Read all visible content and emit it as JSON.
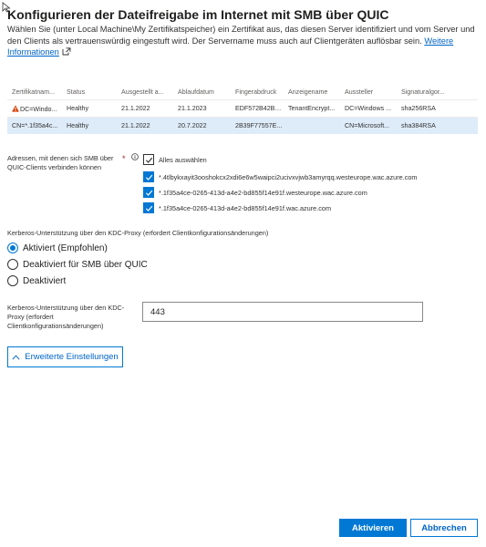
{
  "dialog": {
    "title": "Konfigurieren der Dateifreigabe im Internet mit SMB über QUIC",
    "description": "Wählen Sie (unter Local Machine\\My Zertifikatspeicher) ein Zertifikat aus, das diesen Server identifiziert und vom Server und den Clients als vertrauenswürdig eingestuft wird. Der Servername muss auch auf Clientgeräten auflösbar sein.",
    "link_label": "Weitere Informationen"
  },
  "certificates": {
    "columns": [
      "Zertifikatnam...",
      "Status",
      "Ausgestellt a...",
      "Ablaufdatum",
      "Fingerabdruck",
      "Anzeigename",
      "Aussteller",
      "Signaturalgor..."
    ],
    "rows": [
      {
        "name": "DC=Windo...",
        "status": "Healthy",
        "issued": "21.1.2022",
        "expires": "21.1.2023",
        "thumbprint": "EDF572B42B9...",
        "display_name": "TenantEncrypt...",
        "issuer": "DC=Windows ...",
        "algorithm": "sha256RSA",
        "warning": true,
        "selected": false
      },
      {
        "name": "CN=*.1f35a4c...",
        "status": "Healthy",
        "issued": "21.1.2022",
        "expires": "20.7.2022",
        "thumbprint": "2B39F77557E...",
        "display_name": "",
        "issuer": "CN=Microsoft...",
        "algorithm": "sha384RSA",
        "warning": false,
        "selected": true
      }
    ]
  },
  "addresses": {
    "label": "Adressen, mit denen sich SMB über QUIC-Clients verbinden können",
    "required_mark": "*",
    "select_all_label": "Alles auswählen",
    "items": [
      "*.4tlbykxayit3ooshokcx2xdi6e6w5waipci2ucivxvjwb3amyrqq.westeurope.wac.azure.com",
      "*.1f35a4ce-0265-413d-a4e2-bd855f14e91f.westeurope.wac.azure.com",
      "*.1f35a4ce-0265-413d-a4e2-bd855f14e91f.wac.azure.com"
    ]
  },
  "kerberos": {
    "label": "Kerberos-Unterstützung über den KDC-Proxy (erfordert Clientkonfigurationsänderungen)",
    "options": [
      "Aktiviert (Empfohlen)",
      "Deaktiviert für SMB über QUIC",
      "Deaktiviert"
    ],
    "selected_index": 0,
    "port_label": "Kerberos-Unterstützung über den KDC-Proxy (erfordert Clientkonfigurationsänderungen)",
    "port_value": "443"
  },
  "advanced_label": "Erweiterte Einstellungen",
  "buttons": {
    "activate": "Aktivieren",
    "cancel": "Abbrechen"
  },
  "colors": {
    "accent": "#0078d4",
    "selected_row": "#deecf9",
    "warning": "#d83b01"
  }
}
